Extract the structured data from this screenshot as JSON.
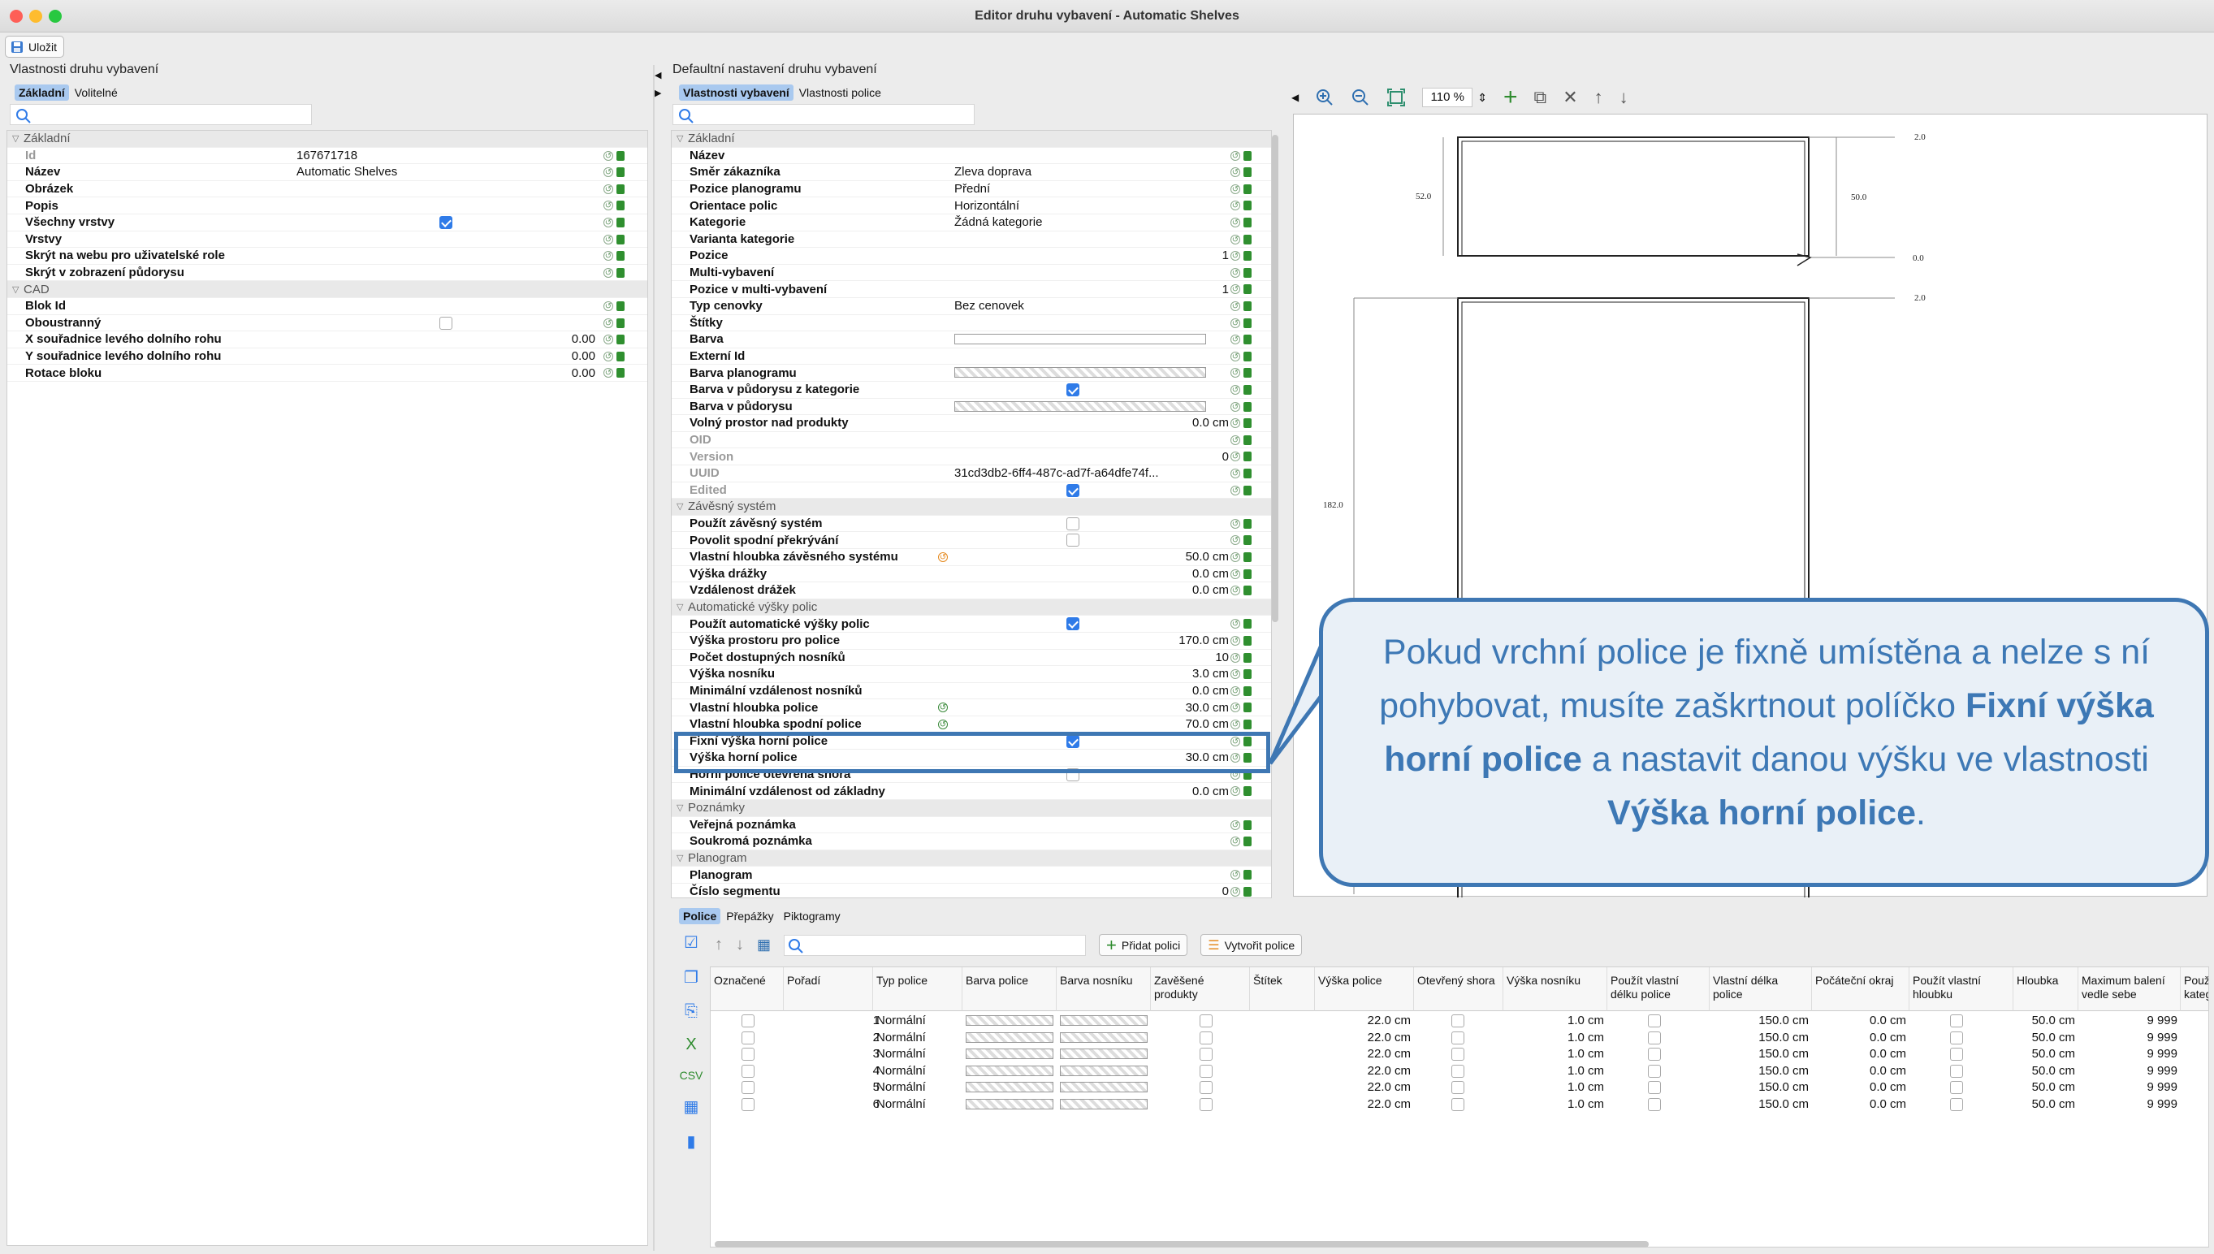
{
  "window": {
    "title": "Editor druhu vybavení - Automatic Shelves",
    "traffic_lights": [
      "#fe5f57",
      "#febc2e",
      "#28c840"
    ]
  },
  "toolbar": {
    "save_label": "Uložit"
  },
  "left_panel": {
    "title": "Vlastnosti druhu vybavení",
    "tabs": [
      "Základní",
      "Volitelné"
    ],
    "rows": [
      {
        "kind": "cat",
        "label": "Základní"
      },
      {
        "kind": "prop",
        "label": "Id",
        "value": "167671718",
        "disabled": true
      },
      {
        "kind": "prop",
        "label": "Název",
        "value": "Automatic Shelves"
      },
      {
        "kind": "prop",
        "label": "Obrázek",
        "value": ""
      },
      {
        "kind": "prop",
        "label": "Popis",
        "value": ""
      },
      {
        "kind": "check",
        "label": "Všechny vrstvy",
        "checked": true
      },
      {
        "kind": "prop",
        "label": "Vrstvy",
        "value": ""
      },
      {
        "kind": "prop",
        "label": "Skrýt na webu pro uživatelské role",
        "value": ""
      },
      {
        "kind": "prop",
        "label": "Skrýt v zobrazení půdorysu",
        "value": ""
      },
      {
        "kind": "cat",
        "label": "CAD"
      },
      {
        "kind": "prop",
        "label": "Blok Id",
        "value": ""
      },
      {
        "kind": "check",
        "label": "Oboustranný",
        "checked": false
      },
      {
        "kind": "num",
        "label": "X souřadnice levého dolního rohu",
        "value": "0.00"
      },
      {
        "kind": "num",
        "label": "Y souřadnice levého dolního rohu",
        "value": "0.00"
      },
      {
        "kind": "num",
        "label": "Rotace bloku",
        "value": "0.00"
      }
    ]
  },
  "middle_panel": {
    "title": "Defaultní nastavení druhu vybavení",
    "tabs": [
      "Vlastnosti vybavení",
      "Vlastnosti police"
    ],
    "rows": [
      {
        "kind": "cat",
        "label": "Základní"
      },
      {
        "kind": "prop",
        "label": "Název",
        "value": ""
      },
      {
        "kind": "prop",
        "label": "Směr zákazníka",
        "value": "Zleva doprava"
      },
      {
        "kind": "prop",
        "label": "Pozice planogramu",
        "value": "Přední"
      },
      {
        "kind": "prop",
        "label": "Orientace polic",
        "value": "Horizontální"
      },
      {
        "kind": "prop",
        "label": "Kategorie",
        "value": "Žádná kategorie"
      },
      {
        "kind": "prop",
        "label": "Varianta kategorie",
        "value": ""
      },
      {
        "kind": "num",
        "label": "Pozice",
        "value": "1"
      },
      {
        "kind": "prop",
        "label": "Multi-vybavení",
        "value": ""
      },
      {
        "kind": "num",
        "label": "Pozice v multi-vybavení",
        "value": "1"
      },
      {
        "kind": "prop",
        "label": "Typ cenovky",
        "value": "Bez cenovek"
      },
      {
        "kind": "prop",
        "label": "Štítky",
        "value": ""
      },
      {
        "kind": "swatch",
        "label": "Barva",
        "style": "white"
      },
      {
        "kind": "prop",
        "label": "Externí Id",
        "value": ""
      },
      {
        "kind": "swatch",
        "label": "Barva planogramu",
        "style": "checker"
      },
      {
        "kind": "check",
        "label": "Barva v půdorysu z kategorie",
        "checked": true
      },
      {
        "kind": "swatch",
        "label": "Barva v půdorysu",
        "style": "checker"
      },
      {
        "kind": "num",
        "label": "Volný prostor nad produkty",
        "value": "0.0 cm"
      },
      {
        "kind": "prop",
        "label": "OID",
        "value": "",
        "disabled": true
      },
      {
        "kind": "num",
        "label": "Version",
        "value": "0",
        "disabled": true
      },
      {
        "kind": "prop",
        "label": "UUID",
        "value": "31cd3db2-6ff4-487c-ad7f-a64dfe74f...",
        "disabled": true
      },
      {
        "kind": "check",
        "label": "Edited",
        "checked": true,
        "disabled": true
      },
      {
        "kind": "cat",
        "label": "Závěsný systém"
      },
      {
        "kind": "check",
        "label": "Použít závěsný systém",
        "checked": false
      },
      {
        "kind": "check",
        "label": "Povolit spodní překrývání",
        "checked": false
      },
      {
        "kind": "num",
        "label": "Vlastní hloubka závěsného systému",
        "value": "50.0 cm",
        "marker": "orange"
      },
      {
        "kind": "num",
        "label": "Výška drážky",
        "value": "0.0 cm"
      },
      {
        "kind": "num",
        "label": "Vzdálenost drážek",
        "value": "0.0 cm"
      },
      {
        "kind": "cat",
        "label": "Automatické výšky polic"
      },
      {
        "kind": "check",
        "label": "Použít automatické výšky polic",
        "checked": true
      },
      {
        "kind": "num",
        "label": "Výška prostoru pro police",
        "value": "170.0 cm"
      },
      {
        "kind": "num",
        "label": "Počet dostupných nosníků",
        "value": "10"
      },
      {
        "kind": "num",
        "label": "Výška nosníku",
        "value": "3.0 cm"
      },
      {
        "kind": "num",
        "label": "Minimální vzdálenost nosníků",
        "value": "0.0 cm"
      },
      {
        "kind": "num",
        "label": "Vlastní hloubka police",
        "value": "30.0 cm",
        "marker": "green"
      },
      {
        "kind": "num",
        "label": "Vlastní hloubka spodní police",
        "value": "70.0 cm",
        "marker": "green"
      },
      {
        "kind": "check",
        "label": "Fixní výška horní police",
        "checked": true
      },
      {
        "kind": "num",
        "label": "Výška horní police",
        "value": "30.0 cm"
      },
      {
        "kind": "check",
        "label": "Horní police otevřená shora",
        "checked": false
      },
      {
        "kind": "num",
        "label": "Minimální vzdálenost od základny",
        "value": "0.0 cm"
      },
      {
        "kind": "cat",
        "label": "Poznámky"
      },
      {
        "kind": "prop",
        "label": "Veřejná poznámka",
        "value": ""
      },
      {
        "kind": "prop",
        "label": "Soukromá poznámka",
        "value": ""
      },
      {
        "kind": "cat",
        "label": "Planogram"
      },
      {
        "kind": "prop",
        "label": "Planogram",
        "value": ""
      },
      {
        "kind": "num",
        "label": "Číslo segmentu",
        "value": "0"
      }
    ]
  },
  "canvas": {
    "zoom": "110 %",
    "dims": {
      "top_right_a": "2.0",
      "top_left": "52.0",
      "top_right_b": "50.0",
      "top_right_c": "0.0",
      "bottom_right": "2.0",
      "bottom_left": "182.0"
    }
  },
  "callout": {
    "part1": "Pokud vrchní police je fixně umístěna a nelze s ní pohybovat, musíte zaškrtnout políčko",
    "bold1": "Fixní výška horní police",
    "part2": "a nastavit danou výšku ve vlastnosti",
    "bold2": "Výška horní police",
    "part3": "."
  },
  "bottom": {
    "tabs": [
      "Police",
      "Přepážky",
      "Piktogramy"
    ],
    "add_shelf": "Přidat polici",
    "create_shelf": "Vytvořit police",
    "columns": [
      "Označené",
      "Pořadí",
      "Typ police",
      "Barva police",
      "Barva nosníku",
      "Zavěšené produkty",
      "Štítek",
      "Výška police",
      "Otevřený shora",
      "Výška nosníku",
      "Použít vlastní délku police",
      "Vlastní délka police",
      "Počáteční okraj",
      "Použít vlastní hloubku",
      "Hloubka",
      "Maximum balení vedle sebe",
      "Použ kateg"
    ],
    "rows": [
      {
        "order": "1",
        "type": "Normální",
        "height": "22.0 cm",
        "beam": "1.0 cm",
        "length": "150.0 cm",
        "margin": "0.0 cm",
        "depth": "50.0 cm",
        "max": "9 999"
      },
      {
        "order": "2",
        "type": "Normální",
        "height": "22.0 cm",
        "beam": "1.0 cm",
        "length": "150.0 cm",
        "margin": "0.0 cm",
        "depth": "50.0 cm",
        "max": "9 999"
      },
      {
        "order": "3",
        "type": "Normální",
        "height": "22.0 cm",
        "beam": "1.0 cm",
        "length": "150.0 cm",
        "margin": "0.0 cm",
        "depth": "50.0 cm",
        "max": "9 999"
      },
      {
        "order": "4",
        "type": "Normální",
        "height": "22.0 cm",
        "beam": "1.0 cm",
        "length": "150.0 cm",
        "margin": "0.0 cm",
        "depth": "50.0 cm",
        "max": "9 999"
      },
      {
        "order": "5",
        "type": "Normální",
        "height": "22.0 cm",
        "beam": "1.0 cm",
        "length": "150.0 cm",
        "margin": "0.0 cm",
        "depth": "50.0 cm",
        "max": "9 999"
      },
      {
        "order": "6",
        "type": "Normální",
        "height": "22.0 cm",
        "beam": "1.0 cm",
        "length": "150.0 cm",
        "margin": "0.0 cm",
        "depth": "50.0 cm",
        "max": "9 999"
      }
    ]
  }
}
